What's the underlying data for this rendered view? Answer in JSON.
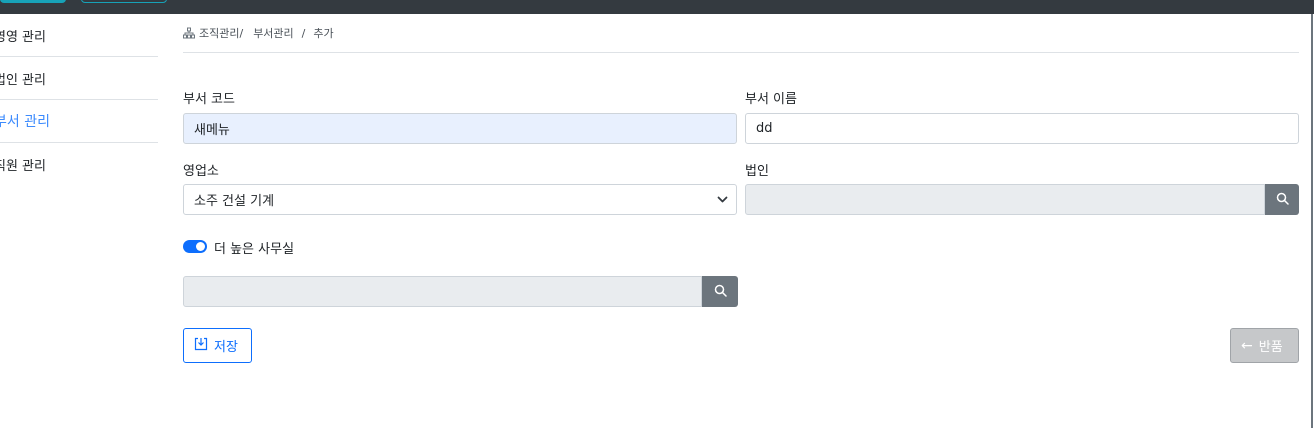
{
  "sidebar": {
    "items": [
      {
        "label": "영영 관리"
      },
      {
        "label": "법인 관리"
      },
      {
        "label": "부서 관리"
      },
      {
        "label": "직원 관리"
      }
    ]
  },
  "breadcrumb": {
    "icon": "org-chart-icon",
    "level1": "조직관리/",
    "level2": "부서관리",
    "separator": "/",
    "level3": "추가"
  },
  "form": {
    "dept_code_label": "부서 코드",
    "dept_code_value": "새메뉴",
    "dept_name_label": "부서 이름",
    "dept_name_value": "dd",
    "office_label": "영업소",
    "office_selected": "소주 건설 기계",
    "corp_label": "법인",
    "corp_value": "",
    "higher_office_label": "더 높은 사무실",
    "higher_office_enabled": true,
    "higher_office_value": ""
  },
  "actions": {
    "save_label": "저장",
    "back_label": "반품"
  },
  "colors": {
    "accent": "#0d6efd",
    "topbar": "#343a40",
    "search_button": "#6c757d"
  }
}
